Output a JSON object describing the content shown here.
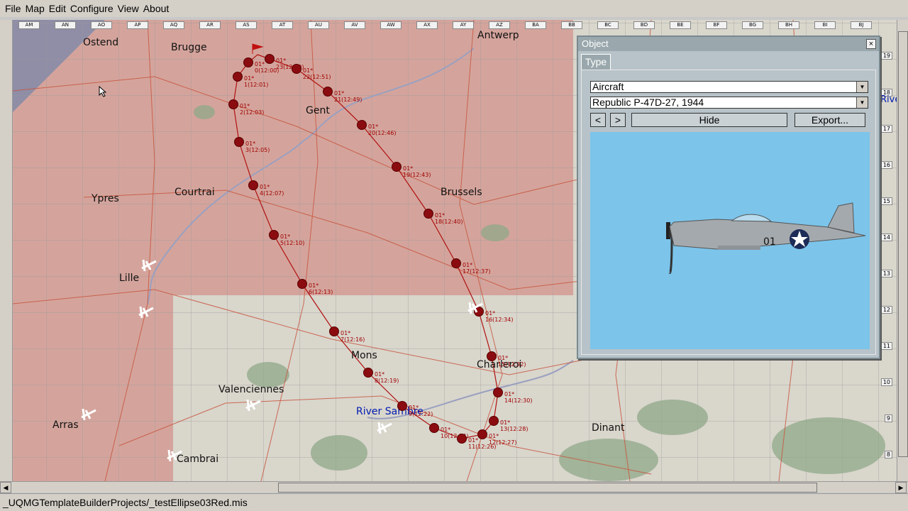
{
  "menu": [
    "File",
    "Map",
    "Edit",
    "Configure",
    "View",
    "About"
  ],
  "map": {
    "columns": [
      "AM",
      "AN",
      "AO",
      "AP",
      "AQ",
      "AR",
      "AS",
      "AT",
      "AU",
      "AV",
      "AW",
      "AX",
      "AY",
      "AZ",
      "BA",
      "BB",
      "BC",
      "BD",
      "BE",
      "BF",
      "BG",
      "BH",
      "BI",
      "BJ"
    ],
    "rows": [
      "19",
      "18",
      "17",
      "16",
      "15",
      "14",
      "13",
      "12",
      "11",
      "10",
      "9",
      "8"
    ],
    "cities": [
      "Ostend",
      "Brugge",
      "Antwerp",
      "Gent",
      "Ypres",
      "Courtrai",
      "Brussels",
      "Lille",
      "Mons",
      "Charleroi",
      "Valenciennes",
      "Arras",
      "Dinant",
      "Cambrai"
    ],
    "river": "River Sambre",
    "clipped_label": "Rive",
    "waypoints": [
      {
        "label": "01*\n23(12:59)"
      },
      {
        "label": "01*\n0(12:00)"
      },
      {
        "label": "01*\n22(12:51)"
      },
      {
        "label": "01*\n1(12:01)"
      },
      {
        "label": "01*\n21(12:49)"
      },
      {
        "label": "01*\n2(12:03)"
      },
      {
        "label": "01*\n20(12:46)"
      },
      {
        "label": "01*\n3(12:05)"
      },
      {
        "label": "01*\n19(12:43)"
      },
      {
        "label": "01*\n4(12:07)"
      },
      {
        "label": "01*\n18(12:40)"
      },
      {
        "label": "01*\n5(12:10)"
      },
      {
        "label": "01*\n17(12:37)"
      },
      {
        "label": "01*\n6(12:13)"
      },
      {
        "label": "01*\n16(12:34)"
      },
      {
        "label": "01*\n7(12:16)"
      },
      {
        "label": "01*\n15(12:32)"
      },
      {
        "label": "01*\n8(12:19)"
      },
      {
        "label": "01*\n14(12:30)"
      },
      {
        "label": "01*\n9(12:22)"
      },
      {
        "label": "01*\n13(12:28)"
      },
      {
        "label": "01*\n10(12:24)"
      },
      {
        "label": "01*\n12(12:27)"
      },
      {
        "label": "01*\n11(12:26)"
      }
    ]
  },
  "dialog": {
    "title": "Object",
    "close": "×",
    "tab": "Type",
    "category": "Aircraft",
    "model": "Republic P-47D-27, 1944",
    "prev": "<",
    "next": ">",
    "hide": "Hide",
    "export": "Export...",
    "aircraft_marking": "01"
  },
  "statusbar": "_UQMGTemplateBuilderProjects/_testEllipse03Red.mis",
  "colors": {
    "red_zone": "#d4a49c",
    "neutral_zone": "#d9d6cc",
    "sea": "#8f8ea6",
    "waypoint": "#8b0c10",
    "preview_sky": "#7cc4ea"
  }
}
